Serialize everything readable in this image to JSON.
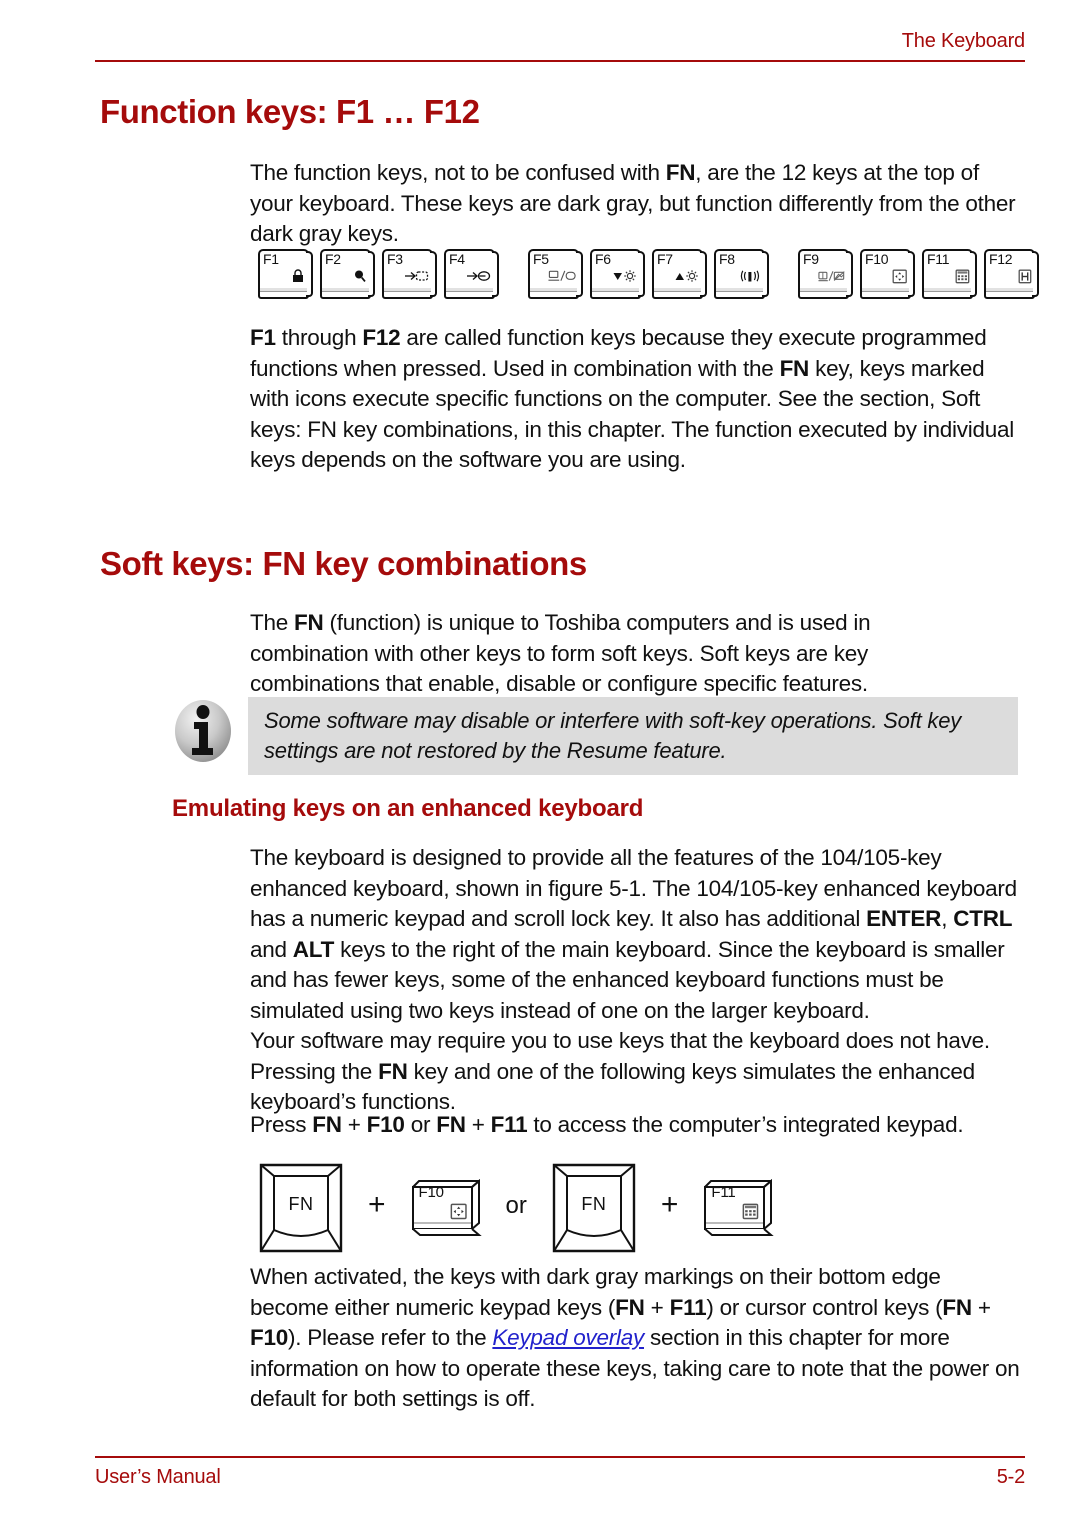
{
  "header": {
    "chapter_title": "The Keyboard",
    "rule_color": "#A50B0B"
  },
  "headings": {
    "h1_function_keys": "Function keys: F1 … F12",
    "h1_soft_keys": "Soft keys: FN key combinations",
    "h2_emulating": "Emulating keys on an enhanced keyboard",
    "color": "#A50B0B"
  },
  "paragraphs": {
    "intro": "The function keys, not to be confused with FN, are the 12 keys at the top of your keyboard. These keys are dark gray, but function differently from the other dark gray keys.",
    "f1_f12": "F1 through F12 are called function keys because they execute programmed functions when pressed. Used in combination with the FN key, keys marked with icons execute specific functions on the computer. See the section, Soft keys: FN key combinations, in this chapter. The function executed by individual keys depends on the software you are using.",
    "fn_intro": "The FN (function) is unique to Toshiba computers and is used in combination with other keys to form soft keys. Soft keys are key combinations that enable, disable or configure specific features.",
    "enhanced": "The keyboard is designed to provide all the features of the 104/105-key enhanced keyboard, shown in figure 5-1. The 104/105-key enhanced keyboard has a numeric keypad and scroll lock key. It also has additional ENTER, CTRL and ALT keys to the right of the main keyboard. Since the keyboard is smaller and has fewer keys, some of the enhanced keyboard functions must be simulated using two keys instead of one on the larger keyboard.",
    "your_software": "Your software may require you to use keys that the keyboard does not have. Pressing the FN key and one of the following keys simulates the enhanced keyboard’s functions.",
    "press_fn": "Press FN + F10 or FN + F11 to access the computer’s integrated keypad.",
    "when_activated": "When activated, the keys with dark gray markings on their bottom edge become either numeric keypad keys (FN + F11) or cursor control keys (FN + F10). Please refer to the Keypad overlay section in this chapter for more information on how to operate these keys, taking care to note that the power on default for both settings is off."
  },
  "inline_emphasis": {
    "fn": "FN",
    "f1": "F1",
    "f10": "F10",
    "f11": "F11",
    "f12": "F12",
    "enter": "ENTER",
    "ctrl": "CTRL",
    "alt": "ALT",
    "keypad_overlay_link": "Keypad overlay",
    "link_color": "#2222CC"
  },
  "note_box": {
    "icon": "info-icon",
    "background": "#DCDCDC",
    "text": "Some software may disable or interfere with soft-key operations. Soft key settings are not restored by the Resume feature."
  },
  "function_key_strip": {
    "groups": [
      {
        "keys": [
          {
            "label": "F1",
            "icon": "padlock-icon"
          },
          {
            "label": "F2",
            "icon": "magnifier-icon"
          },
          {
            "label": "F3",
            "icon": "standby-arrow-icon"
          },
          {
            "label": "F4",
            "icon": "hibernate-arrow-icon"
          }
        ]
      },
      {
        "keys": [
          {
            "label": "F5",
            "icon": "display-switch-icon"
          },
          {
            "label": "F6",
            "icon": "brightness-down-icon"
          },
          {
            "label": "F7",
            "icon": "brightness-up-icon"
          },
          {
            "label": "F8",
            "icon": "wireless-icon"
          }
        ]
      },
      {
        "keys": [
          {
            "label": "F9",
            "icon": "touchpad-icon"
          },
          {
            "label": "F10",
            "icon": "cursor-overlay-icon"
          },
          {
            "label": "F11",
            "icon": "numeric-keypad-icon"
          },
          {
            "label": "F12",
            "icon": "scroll-lock-icon"
          }
        ]
      }
    ]
  },
  "fn_figure": {
    "fn_label_1": "FN",
    "plus_1": "+",
    "key_1": {
      "label": "F10",
      "icon": "cursor-overlay-icon"
    },
    "or_label": "or",
    "fn_label_2": "FN",
    "plus_2": "+",
    "key_2": {
      "label": "F11",
      "icon": "numeric-keypad-icon"
    }
  },
  "footer": {
    "left": "User’s Manual",
    "right": "5-2",
    "color": "#A50B0B"
  }
}
